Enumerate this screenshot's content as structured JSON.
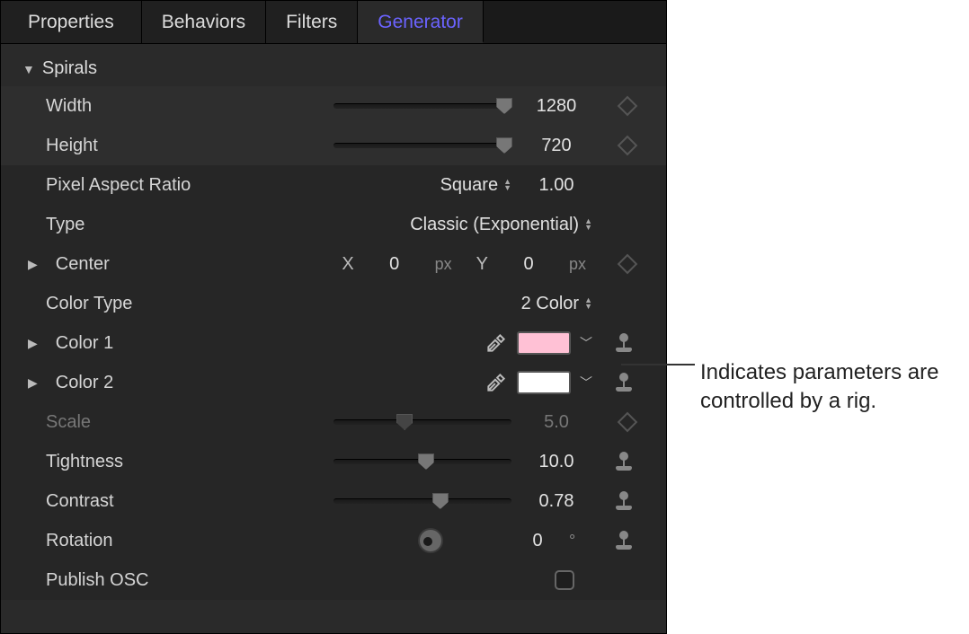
{
  "tabs": {
    "properties": "Properties",
    "behaviors": "Behaviors",
    "filters": "Filters",
    "generator": "Generator"
  },
  "section": {
    "title": "Spirals"
  },
  "params": {
    "width": {
      "label": "Width",
      "value": "1280"
    },
    "height": {
      "label": "Height",
      "value": "720"
    },
    "par": {
      "label": "Pixel Aspect Ratio",
      "option": "Square",
      "value": "1.00"
    },
    "type": {
      "label": "Type",
      "option": "Classic (Exponential)"
    },
    "center": {
      "label": "Center",
      "xLabel": "X",
      "xValue": "0",
      "xUnit": "px",
      "yLabel": "Y",
      "yValue": "0",
      "yUnit": "px"
    },
    "colortype": {
      "label": "Color Type",
      "option": "2 Color"
    },
    "color1": {
      "label": "Color 1",
      "swatch": "#ffc1d5"
    },
    "color2": {
      "label": "Color 2",
      "swatch": "#ffffff"
    },
    "scale": {
      "label": "Scale",
      "value": "5.0"
    },
    "tightness": {
      "label": "Tightness",
      "value": "10.0"
    },
    "contrast": {
      "label": "Contrast",
      "value": "0.78"
    },
    "rotation": {
      "label": "Rotation",
      "value": "0",
      "unit": "°"
    },
    "publish": {
      "label": "Publish OSC"
    }
  },
  "callout": {
    "text": "Indicates parameters are controlled by a rig."
  }
}
